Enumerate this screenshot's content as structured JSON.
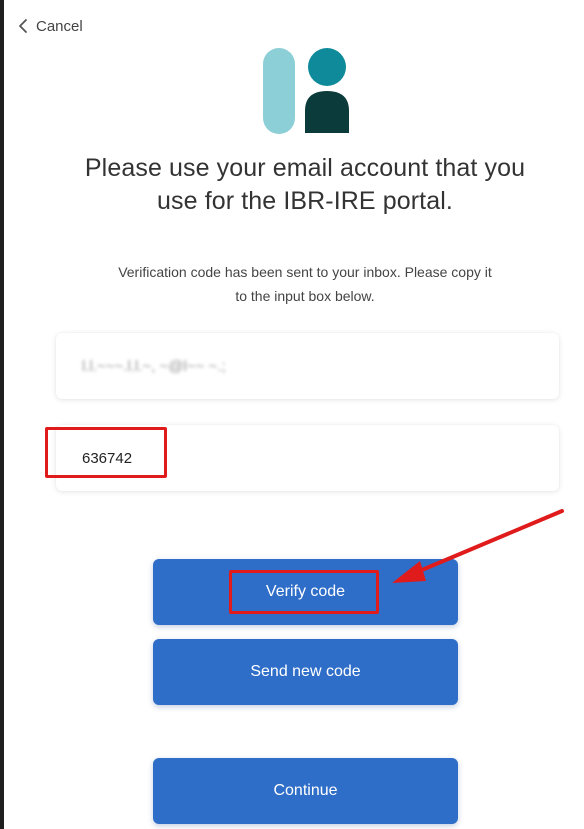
{
  "header": {
    "cancel_label": "Cancel"
  },
  "heading": {
    "title_line1": "Please use your email account that you",
    "title_line2": "use for the IBR-IRE portal."
  },
  "message": {
    "line1": "Verification code has been sent to your inbox. Please copy it",
    "line2": "to the input box below."
  },
  "form": {
    "email_value": "l.l.~~~.l.l.~, ~@l~~ ~.;",
    "code_value": "636742"
  },
  "buttons": {
    "verify": "Verify code",
    "send_new": "Send new code",
    "continue": "Continue"
  },
  "colors": {
    "primary_button": "#2f6ec8",
    "annotation_red": "#e01b1b",
    "logo_light": "#8ccfd6",
    "logo_teal": "#0e8a9a",
    "logo_dark": "#0b3b3b"
  },
  "icons": {
    "back": "chevron-left-icon",
    "logo": "brand-logo-icon"
  }
}
